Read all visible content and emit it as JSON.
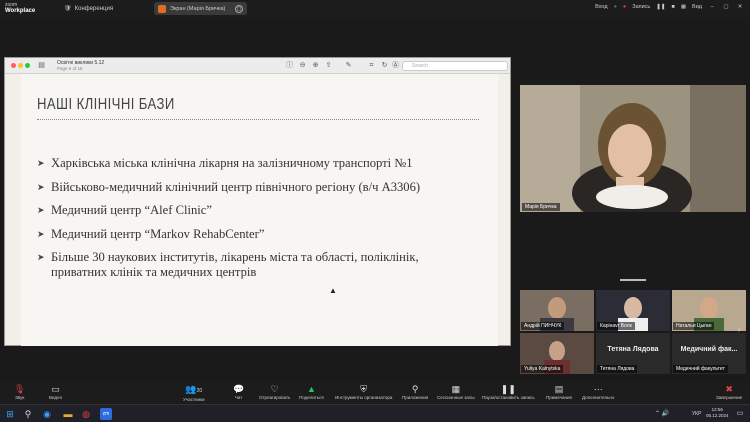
{
  "app": {
    "logo_line1": "zoom",
    "logo_line2": "Workplace"
  },
  "topbar": {
    "conference_label": "Конференция",
    "share_label": "Экран (Марія Бричка)",
    "view_label": "Вид",
    "sound_label": "Вход",
    "record_label": "Запись",
    "colors": {
      "share_badge": "#e07020",
      "record": "#e04040"
    }
  },
  "window": {
    "doc_title": "Освітні виклики 5.12",
    "doc_subtitle": "Page 6 of 16",
    "search_placeholder": "Search",
    "icons": [
      "sidebar-icon",
      "info-icon",
      "zoom-out-icon",
      "zoom-in-icon",
      "share-icon",
      "pen-icon",
      "crop-icon",
      "rotate-icon",
      "markup-icon"
    ]
  },
  "slide": {
    "heading": "НАШІ КЛІНІЧНІ БАЗИ",
    "bullets": [
      "Харківська міська клінічна лікарня на залізничному транспорті №1",
      "Військово-медичний клінічний центр північного регіону (в/ч А3306)",
      "Медичний центр “Alef Clinic”",
      "Медичний центр “Markov RehabCenter”",
      "Більше 30 наукових інститутів, лікарень міста та області, поліклінік, приватних клінік та медичних центрів"
    ]
  },
  "main_video": {
    "name": "Марія Бричка"
  },
  "thumbnails": [
    {
      "name": "Андрій ПИНЧУК",
      "big": ""
    },
    {
      "name": "Карінаvr Волк",
      "big": ""
    },
    {
      "name": "Наталья Цыган",
      "big": ""
    },
    {
      "name": "Yuliya Kalnytska",
      "big": ""
    },
    {
      "name": "Тетяна Лядова",
      "big": "Тетяна Лядова"
    },
    {
      "name": "Медичний факультет",
      "big": "Медичний фак..."
    }
  ],
  "toolbar": {
    "sound": "Звук",
    "video": "Видео",
    "participants": "Участники",
    "participants_count": "20",
    "chat": "Чат",
    "react": "Отреагировать",
    "share": "Поделиться",
    "host_tools": "Инструменты организатора",
    "apps": "Приложения",
    "rooms": "Сессионные залы",
    "pause": "Пауза/остановить запись",
    "notes": "Примечания",
    "more": "Дополнительно",
    "end": "Завершение"
  },
  "taskbar": {
    "lang": "УКР",
    "time": "12:56",
    "date": "05.12.2024"
  }
}
